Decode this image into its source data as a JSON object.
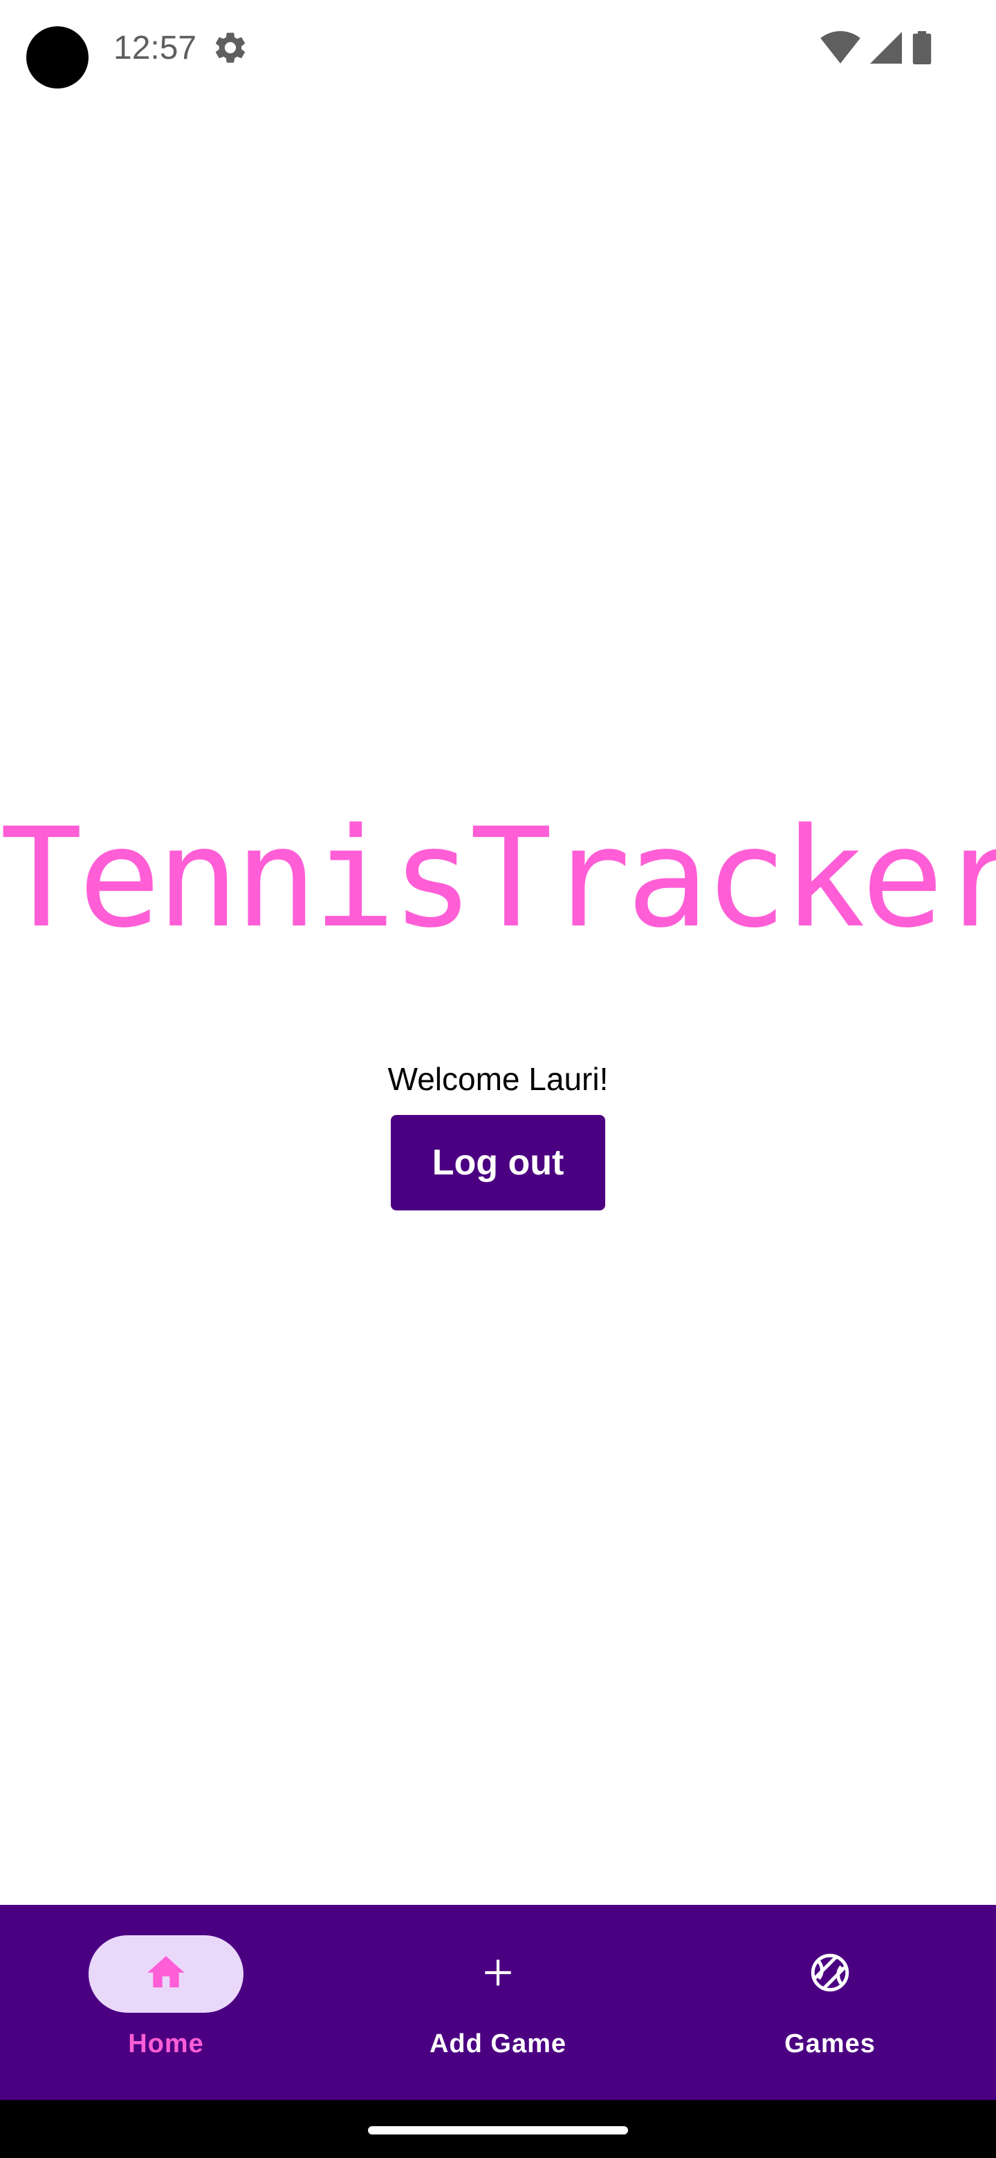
{
  "status_bar": {
    "time": "12:57",
    "icons": [
      "settings-gear-icon",
      "wifi-icon",
      "cellular-signal-icon",
      "battery-icon"
    ]
  },
  "main": {
    "app_title": "TennisTracker",
    "welcome": "Welcome Lauri!",
    "logout_label": "Log out"
  },
  "nav": {
    "items": [
      {
        "label": "Home",
        "icon": "home-icon",
        "active": true
      },
      {
        "label": "Add Game",
        "icon": "plus-icon",
        "active": false
      },
      {
        "label": "Games",
        "icon": "tennis-ball-icon",
        "active": false
      }
    ]
  },
  "colors": {
    "accent_pink": "#ff5ed6",
    "brand_purple": "#4b0082",
    "active_pill": "#ead8fb",
    "background": "#ffffff"
  }
}
